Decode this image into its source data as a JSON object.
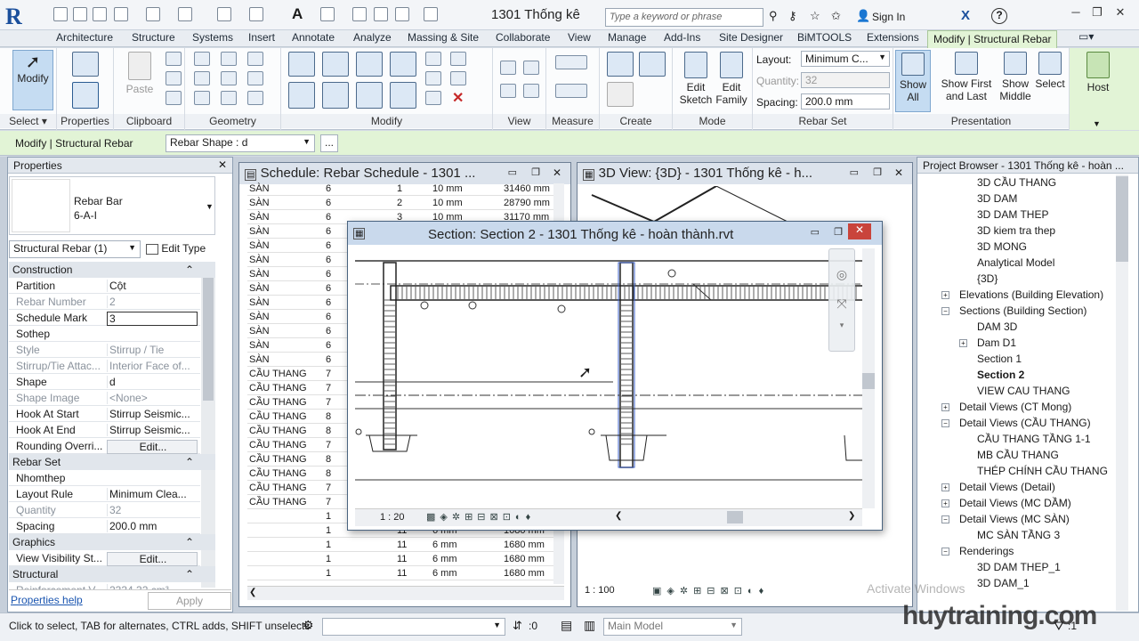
{
  "title_bar": {
    "document_title": "1301 Thống kê",
    "search_placeholder": "Type a keyword or phrase",
    "sign_in": "Sign In"
  },
  "ribbon_tabs": [
    "Architecture",
    "Structure",
    "Systems",
    "Insert",
    "Annotate",
    "Analyze",
    "Massing & Site",
    "Collaborate",
    "View",
    "Manage",
    "Add-Ins",
    "Site Designer",
    "BiMTOOLS",
    "Extensions"
  ],
  "active_tab": "Modify | Structural Rebar",
  "ribbon": {
    "select": {
      "modify": "Modify",
      "label": "Select"
    },
    "properties": {
      "label": "Properties"
    },
    "clipboard": {
      "paste": "Paste",
      "label": "Clipboard"
    },
    "geometry": {
      "label": "Geometry"
    },
    "modify": {
      "label": "Modify"
    },
    "view": {
      "label": "View"
    },
    "measure": {
      "label": "Measure"
    },
    "create": {
      "label": "Create"
    },
    "mode": {
      "edit_sketch": "Edit Sketch",
      "edit_family": "Edit Family",
      "label": "Mode"
    },
    "rebar_set": {
      "layout_label": "Layout:",
      "layout_value": "Minimum C...",
      "quantity_label": "Quantity:",
      "quantity_value": "32",
      "spacing_label": "Spacing:",
      "spacing_value": "200.0 mm",
      "label": "Rebar Set"
    },
    "presentation": {
      "show_all": "Show All",
      "show_first_last": "Show First and Last",
      "show_middle": "Show Middle",
      "select": "Select",
      "label": "Presentation"
    },
    "host": "Host"
  },
  "options_bar": {
    "context": "Modify | Structural Rebar",
    "shape_value": "Rebar Shape : d",
    "more": "..."
  },
  "properties": {
    "title": "Properties",
    "type_name": "Rebar Bar",
    "type_sub": "6-A-I",
    "selector": "Structural Rebar (1)",
    "edit_type": "Edit Type",
    "groups": {
      "construction": "Construction",
      "rebar_set": "Rebar Set",
      "graphics": "Graphics",
      "structural": "Structural"
    },
    "rows": [
      {
        "k": "Partition",
        "v": "Cột",
        "gray": false
      },
      {
        "k": "Rebar Number",
        "v": "2",
        "gray": true
      },
      {
        "k": "Schedule Mark",
        "v": "3",
        "gray": false
      },
      {
        "k": "Sothep",
        "v": "",
        "gray": false
      },
      {
        "k": "Style",
        "v": "Stirrup / Tie",
        "gray": true
      },
      {
        "k": "Stirrup/Tie Attac...",
        "v": "Interior Face of...",
        "gray": true
      },
      {
        "k": "Shape",
        "v": "d",
        "gray": false
      },
      {
        "k": "Shape Image",
        "v": "<None>",
        "gray": true
      },
      {
        "k": "Hook At Start",
        "v": "Stirrup Seismic...",
        "gray": false
      },
      {
        "k": "Hook At End",
        "v": "Stirrup Seismic...",
        "gray": false
      },
      {
        "k": "Rounding Overri...",
        "v": "Edit...",
        "gray": false
      }
    ],
    "rows2": [
      {
        "k": "Nhomthep",
        "v": "",
        "gray": false
      },
      {
        "k": "Layout Rule",
        "v": "Minimum Clea...",
        "gray": false
      },
      {
        "k": "Quantity",
        "v": "32",
        "gray": true
      },
      {
        "k": "Spacing",
        "v": "200.0 mm",
        "gray": false
      }
    ],
    "rows3": [
      {
        "k": "View Visibility St...",
        "v": "Edit...",
        "gray": false
      }
    ],
    "rows4": [
      {
        "k": "Reinforcement V...",
        "v": "2334.32 cm³",
        "gray": true
      }
    ],
    "help": "Properties help",
    "apply": "Apply"
  },
  "schedule": {
    "title": "Schedule: Rebar Schedule - 1301 ...",
    "rows": [
      [
        "SÀN",
        "6",
        "1",
        "10 mm",
        "31460 mm"
      ],
      [
        "SÀN",
        "6",
        "2",
        "10 mm",
        "28790 mm"
      ],
      [
        "SÀN",
        "6",
        "3",
        "10 mm",
        "31170 mm"
      ],
      [
        "SÀN",
        "6",
        "",
        "",
        ""
      ],
      [
        "SÀN",
        "6",
        "",
        "",
        ""
      ],
      [
        "SÀN",
        "6",
        "",
        "",
        ""
      ],
      [
        "SÀN",
        "6",
        "",
        "",
        ""
      ],
      [
        "SÀN",
        "6",
        "",
        "",
        ""
      ],
      [
        "SÀN",
        "6",
        "",
        "",
        ""
      ],
      [
        "SÀN",
        "6",
        "",
        "",
        ""
      ],
      [
        "SÀN",
        "6",
        "",
        "",
        ""
      ],
      [
        "SÀN",
        "6",
        "",
        "",
        ""
      ],
      [
        "SÀN",
        "6",
        "",
        "",
        ""
      ],
      [
        "CẦU THANG",
        "7",
        "",
        "",
        ""
      ],
      [
        "CẦU THANG",
        "7",
        "",
        "",
        ""
      ],
      [
        "CẦU THANG",
        "7",
        "",
        "",
        ""
      ],
      [
        "CẦU THANG",
        "8",
        "",
        "",
        ""
      ],
      [
        "CẦU THANG",
        "8",
        "",
        "",
        ""
      ],
      [
        "CẦU THANG",
        "7",
        "",
        "",
        ""
      ],
      [
        "CẦU THANG",
        "8",
        "",
        "",
        ""
      ],
      [
        "CẦU THANG",
        "8",
        "",
        "",
        ""
      ],
      [
        "CẦU THANG",
        "7",
        "",
        "",
        ""
      ],
      [
        "CẦU THANG",
        "7",
        "",
        "",
        ""
      ],
      [
        "",
        "1",
        "",
        "",
        ""
      ],
      [
        "",
        "1",
        "11",
        "6 mm",
        "1680 mm"
      ],
      [
        "",
        "1",
        "11",
        "6 mm",
        "1680 mm"
      ],
      [
        "",
        "1",
        "11",
        "6 mm",
        "1680 mm"
      ],
      [
        "",
        "1",
        "11",
        "6 mm",
        "1680 mm"
      ]
    ]
  },
  "view3d": {
    "title": "3D View: {3D} - 1301 Thống kê - h...",
    "scale": "1 : 100"
  },
  "section": {
    "title": "Section: Section 2 - 1301 Thống kê - hoàn thành.rvt",
    "scale": "1 : 20"
  },
  "project_browser": {
    "title": "Project Browser - 1301 Thống kê - hoàn ...",
    "nodes": [
      {
        "t": "3D CẦU THANG",
        "lvl": 2,
        "tog": ""
      },
      {
        "t": "3D DAM",
        "lvl": 2,
        "tog": ""
      },
      {
        "t": "3D DAM THEP",
        "lvl": 2,
        "tog": ""
      },
      {
        "t": "3D kiem tra thep",
        "lvl": 2,
        "tog": ""
      },
      {
        "t": "3D MONG",
        "lvl": 2,
        "tog": ""
      },
      {
        "t": "Analytical Model",
        "lvl": 2,
        "tog": ""
      },
      {
        "t": "{3D}",
        "lvl": 2,
        "tog": ""
      },
      {
        "t": "Elevations (Building Elevation)",
        "lvl": 1,
        "tog": "+"
      },
      {
        "t": "Sections (Building Section)",
        "lvl": 1,
        "tog": "-"
      },
      {
        "t": "DAM 3D",
        "lvl": 2,
        "tog": ""
      },
      {
        "t": "Dam D1",
        "lvl": 2,
        "tog": "+"
      },
      {
        "t": "Section 1",
        "lvl": 2,
        "tog": ""
      },
      {
        "t": "Section 2",
        "lvl": 2,
        "tog": "",
        "bold": true
      },
      {
        "t": "VIEW CAU THANG",
        "lvl": 2,
        "tog": ""
      },
      {
        "t": "Detail Views (CT Mong)",
        "lvl": 1,
        "tog": "+"
      },
      {
        "t": "Detail Views (CẦU THANG)",
        "lvl": 1,
        "tog": "-"
      },
      {
        "t": "CẦU THANG TẦNG 1-1",
        "lvl": 2,
        "tog": ""
      },
      {
        "t": "MB CẦU THANG",
        "lvl": 2,
        "tog": ""
      },
      {
        "t": "THÉP CHÍNH CẦU THANG",
        "lvl": 2,
        "tog": ""
      },
      {
        "t": "Detail Views (Detail)",
        "lvl": 1,
        "tog": "+"
      },
      {
        "t": "Detail Views (MC DẦM)",
        "lvl": 1,
        "tog": "+"
      },
      {
        "t": "Detail Views (MC SÀN)",
        "lvl": 1,
        "tog": "-"
      },
      {
        "t": "MC SÀN TẦNG 3",
        "lvl": 2,
        "tog": ""
      },
      {
        "t": "Renderings",
        "lvl": 1,
        "tog": "-"
      },
      {
        "t": "3D DAM THEP_1",
        "lvl": 2,
        "tog": ""
      },
      {
        "t": "3D DAM_1",
        "lvl": 2,
        "tog": ""
      }
    ]
  },
  "status": {
    "hint": "Click to select, TAB for alternates, CTRL adds, SHIFT unselects",
    "worksets": ":0",
    "model": "Main Model",
    "watermark": "huytraining.com",
    "activate": "Activate Windows",
    "filter": ":1"
  }
}
